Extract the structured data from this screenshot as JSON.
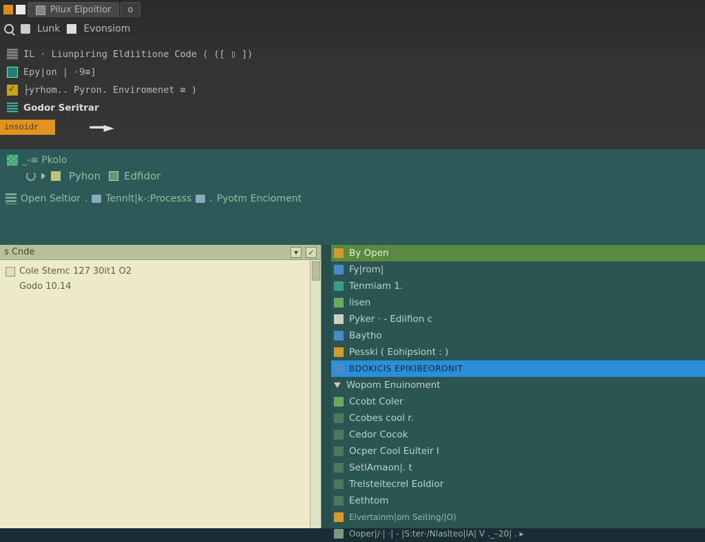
{
  "tabbar": {
    "tab1_icon_label": "P",
    "tab1_label": "Pilux  Elpoitior",
    "tab2_label": "o"
  },
  "toolbar2": {
    "item1": "Lunk",
    "item2": "Evonsiom"
  },
  "sections": {
    "row1": "IL · Liunpiring Eldiitione Code ⟨ ([ ▯ ])",
    "row2": "Epy|on | ·9≡]",
    "row3": "├yrhom.. Pyron. Enviromenet ≡ )",
    "row4": "Godor Seritrar"
  },
  "active_tab": "insoidr",
  "mid": {
    "line1": "_-≡ Pkolo",
    "line2a": "Pyhon",
    "line2b": "Edfidor",
    "line3_a": "Open Seltior",
    "line3_b": "Tennlt|k-:Processs",
    "line3_c": "Pyotm Encioment"
  },
  "left": {
    "header": "s Cnde",
    "row1": "Cole Stemc 127 30it1 O2",
    "row2": "Godo 10.14"
  },
  "right": {
    "items": [
      {
        "ic": "or",
        "label": "By Open",
        "sel": "sel1"
      },
      {
        "ic": "bl",
        "label": "Fy|rom|"
      },
      {
        "ic": "te",
        "label": "Tenmiam 1."
      },
      {
        "ic": "gr",
        "label": "lisen"
      },
      {
        "ic": "wh",
        "label": "Pyker · - Ediifion c"
      },
      {
        "ic": "bl",
        "label": "Baytho"
      },
      {
        "ic": "or",
        "label": "Pesski ( Eohipsiont : )"
      },
      {
        "ic": "bl",
        "label": "BDOKICIS EPIKIBEORONIT",
        "sel": "sel2"
      },
      {
        "ic": "tri",
        "label": "Wopom Enuinoment"
      },
      {
        "ic": "gr",
        "label": "Ccobt Coler"
      },
      {
        "ic": "dg",
        "label": "Ccobes cool r."
      },
      {
        "ic": "dg",
        "label": "Cedor Cocok"
      },
      {
        "ic": "dg",
        "label": "Ocper Cool Eulteir I"
      },
      {
        "ic": "dg",
        "label": "SetlAmaon|. t"
      },
      {
        "ic": "dg",
        "label": "Trelsteitecrel  Eoldior"
      },
      {
        "ic": "dg",
        "label": "Eethtom"
      },
      {
        "ic": "or",
        "label": "Elvertainm|om Seiting/|O)",
        "small": true
      },
      {
        "ic": "txt",
        "label": "Ooper|/·| ·| -  |S:ter·/Nlaslteo|lA|  V ._–20| . ▸",
        "small": true
      }
    ]
  }
}
